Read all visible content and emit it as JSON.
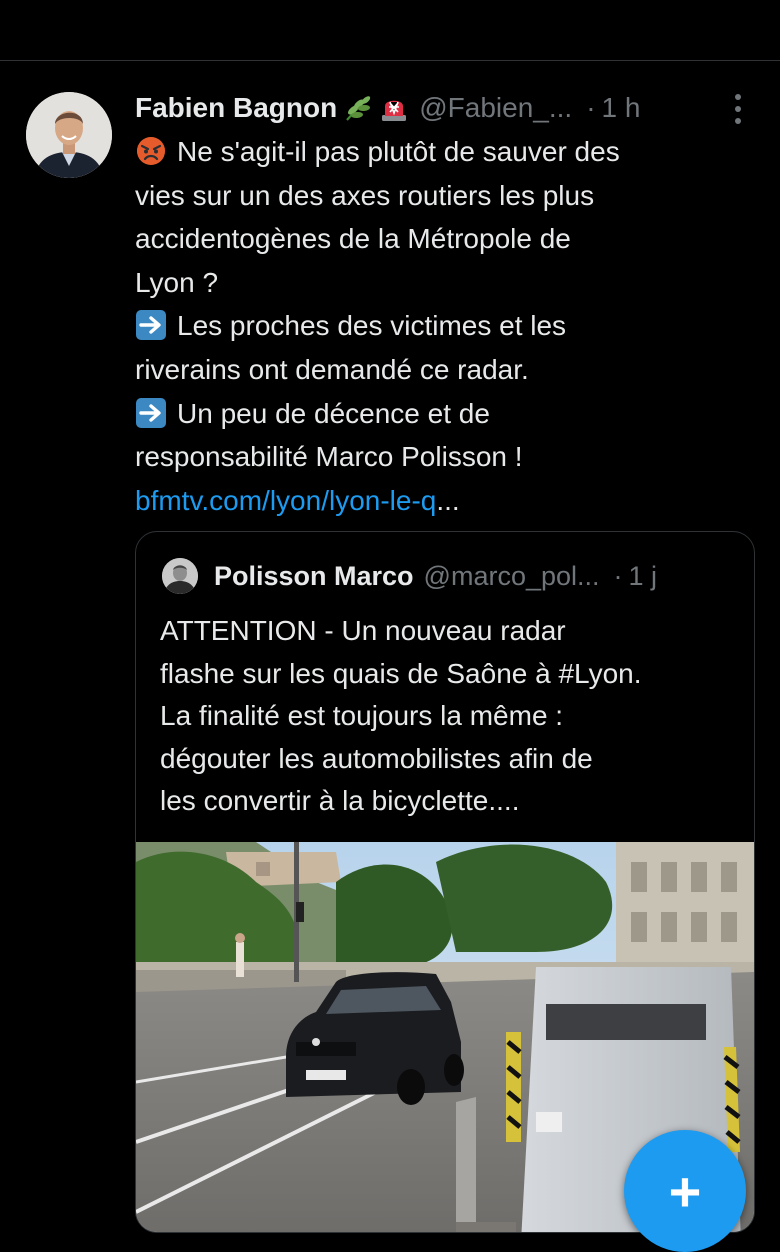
{
  "tweet": {
    "author_name": "Fabien Bagnon",
    "emojis": [
      "herb-emoji",
      "rotating-light-emoji"
    ],
    "handle": "@Fabien_...",
    "separator": "·",
    "time": "1 h",
    "lines": [
      "Ne s'agit-il pas plutôt de sauver des",
      "vies sur un des axes routiers les plus",
      "accidentogènes de la Métropole de",
      "Lyon ?",
      "Les proches des victimes et les",
      "riverains ont demandé ce radar.",
      "Un peu de décence et de",
      "responsabilité Marco Polisson !"
    ],
    "link": "bfmtv.com/lyon/lyon-le-q",
    "link_ellipsis": "...",
    "icons": {
      "angry": "angry-face-emoji",
      "arrow": "right-arrow-emoji",
      "more": "more-options-icon"
    }
  },
  "quoted_tweet": {
    "author_name": "Polisson Marco",
    "handle": "@marco_pol...",
    "separator": "·",
    "time": "1 j",
    "lines": [
      "ATTENTION - Un nouveau radar",
      "flashe sur les quais de Saône à #Lyon.",
      "La finalité est toujours la même :",
      "dégouter les automobilistes afin de",
      "les convertir à la bicyclette...."
    ],
    "media": "photo-speed-camera-quay"
  },
  "compose_button": {
    "label": "+"
  },
  "colors": {
    "background": "#000000",
    "text": "#e7e9ea",
    "muted": "#71767b",
    "link": "#1d9bf0",
    "accent": "#1d9bf0",
    "border": "#2f3336"
  }
}
